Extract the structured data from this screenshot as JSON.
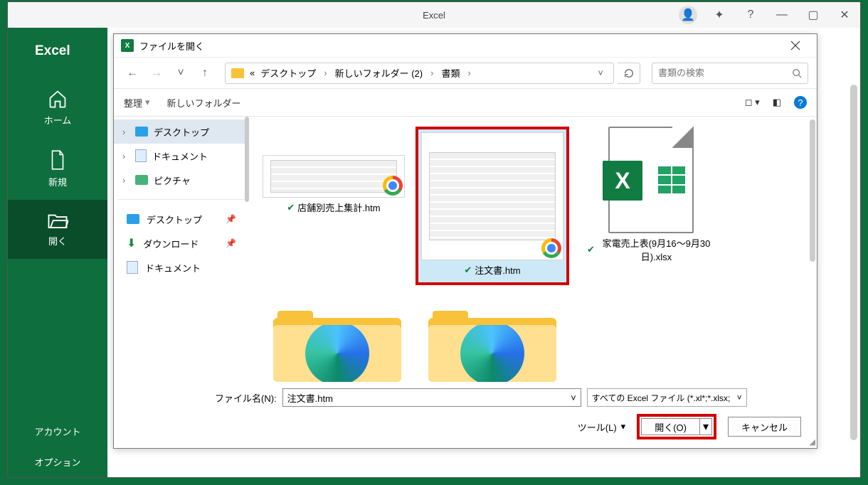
{
  "app": {
    "title": "Excel",
    "brand": "Excel"
  },
  "window_controls": {
    "minimize": "—",
    "maximize": "▢",
    "close": "✕",
    "help": "?"
  },
  "sidebar": {
    "items": [
      {
        "label": "ホーム"
      },
      {
        "label": "新規"
      },
      {
        "label": "開く"
      }
    ],
    "account": "アカウント",
    "options": "オプション"
  },
  "dialog": {
    "title": "ファイルを開く",
    "breadcrumb": {
      "prefix": "«",
      "segments": [
        "デスクトップ",
        "新しいフォルダー (2)",
        "書類"
      ]
    },
    "search_placeholder": "書類の検索",
    "toolbar": {
      "organize": "整理",
      "new_folder": "新しいフォルダー"
    },
    "tree": {
      "desktop": "デスクトップ",
      "documents": "ドキュメント",
      "pictures": "ピクチャ"
    },
    "quick": {
      "desktop": "デスクトップ",
      "downloads": "ダウンロード",
      "documents": "ドキュメント"
    },
    "files": [
      {
        "name": "店舗別売上集計.htm",
        "type": "htm"
      },
      {
        "name": "注文書.htm",
        "type": "htm",
        "selected": true
      },
      {
        "name": "家電売上表(9月16～9月30日).xlsx",
        "type": "xlsx"
      }
    ],
    "filename_label": "ファイル名(N):",
    "filename_value": "注文書.htm",
    "filetype": "すべての Excel ファイル (*.xl*;*.xlsx;",
    "tools": "ツール(L)",
    "open": "開く(O)",
    "cancel": "キャンセル"
  }
}
